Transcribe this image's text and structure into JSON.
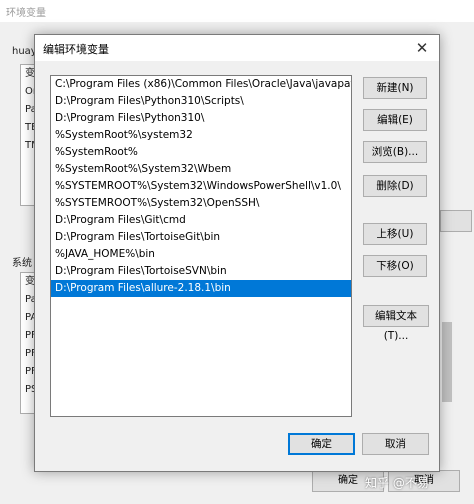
{
  "parent": {
    "title": "环境变量",
    "user_group_label": "huay",
    "user_list_partial": [
      "变",
      "On",
      "Pa",
      "TE",
      "TM"
    ],
    "system_group_label": "系统",
    "system_list_partial": [
      "变",
      "Pa",
      "PA",
      "PF",
      "PF",
      "PF",
      "PS"
    ],
    "ok_label": "确定",
    "cancel_label": "取消"
  },
  "dialog": {
    "title": "编辑环境变量",
    "paths": [
      "C:\\Program Files (x86)\\Common Files\\Oracle\\Java\\javapath",
      "D:\\Program Files\\Python310\\Scripts\\",
      "D:\\Program Files\\Python310\\",
      "%SystemRoot%\\system32",
      "%SystemRoot%",
      "%SystemRoot%\\System32\\Wbem",
      "%SYSTEMROOT%\\System32\\WindowsPowerShell\\v1.0\\",
      "%SYSTEMROOT%\\System32\\OpenSSH\\",
      "D:\\Program Files\\Git\\cmd",
      "D:\\Program Files\\TortoiseGit\\bin",
      "%JAVA_HOME%\\bin",
      "D:\\Program Files\\TortoiseSVN\\bin",
      "D:\\Program Files\\allure-2.18.1\\bin"
    ],
    "selected_index": 12,
    "buttons": {
      "new": "新建(N)",
      "edit": "编辑(E)",
      "browse": "浏览(B)...",
      "delete": "删除(D)",
      "move_up": "上移(U)",
      "move_down": "下移(O)",
      "edit_text": "编辑文本(T)..."
    },
    "ok_label": "确定",
    "cancel_label": "取消"
  },
  "watermark": "知乎 @不易",
  "colors": {
    "selection": "#0078d7",
    "dialog_bg": "#f0f0f0"
  }
}
